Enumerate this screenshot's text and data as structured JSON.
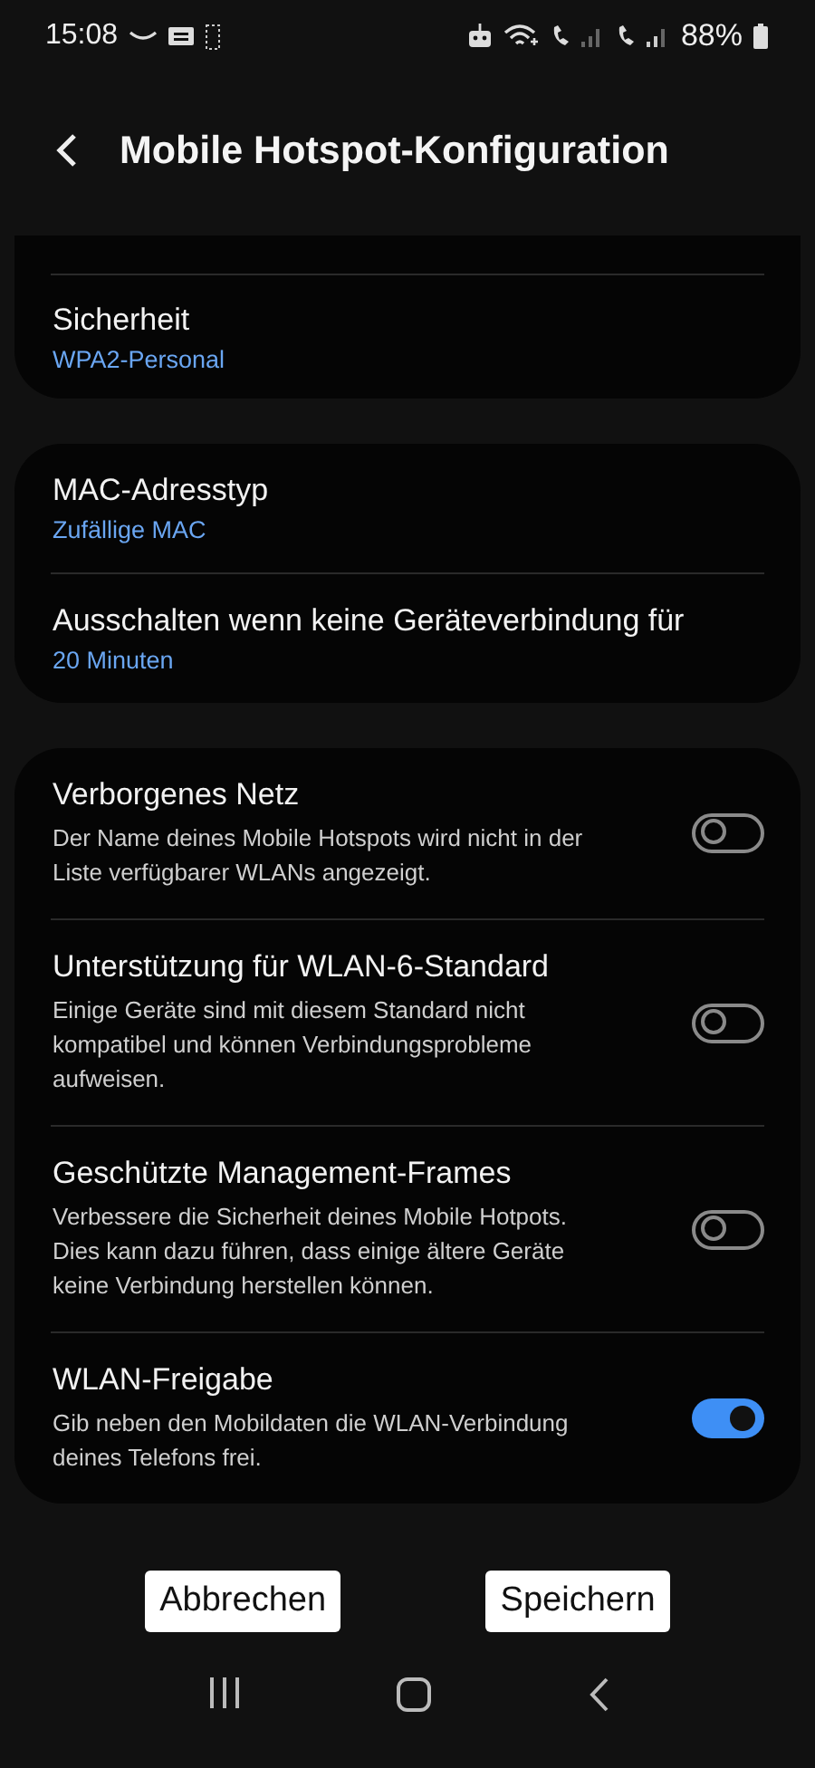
{
  "status_bar": {
    "time": "15:08",
    "battery": "88%"
  },
  "header": {
    "title": "Mobile Hotspot-Konfiguration"
  },
  "groups": [
    {
      "items": [
        {
          "kind": "value",
          "title": "Sicherheit",
          "value": "WPA2-Personal"
        }
      ]
    },
    {
      "items": [
        {
          "kind": "value",
          "title": "MAC-Adresstyp",
          "value": "Zufällige MAC"
        },
        {
          "kind": "value",
          "title": "Ausschalten wenn keine Geräteverbindung für",
          "value": "20 Minuten"
        }
      ]
    },
    {
      "items": [
        {
          "kind": "switch",
          "title": "Verborgenes Netz",
          "description": "Der Name deines Mobile Hotspots wird nicht in der Liste verfügbarer WLANs angezeigt.",
          "on": false
        },
        {
          "kind": "switch",
          "title": "Unterstützung für WLAN-6-Standard",
          "description": "Einige Geräte sind mit diesem Standard nicht kompatibel und können Verbindungsprobleme aufweisen.",
          "on": false
        },
        {
          "kind": "switch",
          "title": "Geschützte Management-Frames",
          "description": "Verbessere die Sicherheit deines Mobile Hotpots. Dies kann dazu führen, dass einige ältere Geräte keine Verbindung herstellen können.",
          "on": false
        },
        {
          "kind": "switch",
          "title": "WLAN-Freigabe",
          "description": "Gib neben den Mobildaten die WLAN-Verbindung deines Telefons frei.",
          "on": true
        }
      ]
    }
  ],
  "buttons": [
    "Abbrechen",
    "Speichern"
  ]
}
